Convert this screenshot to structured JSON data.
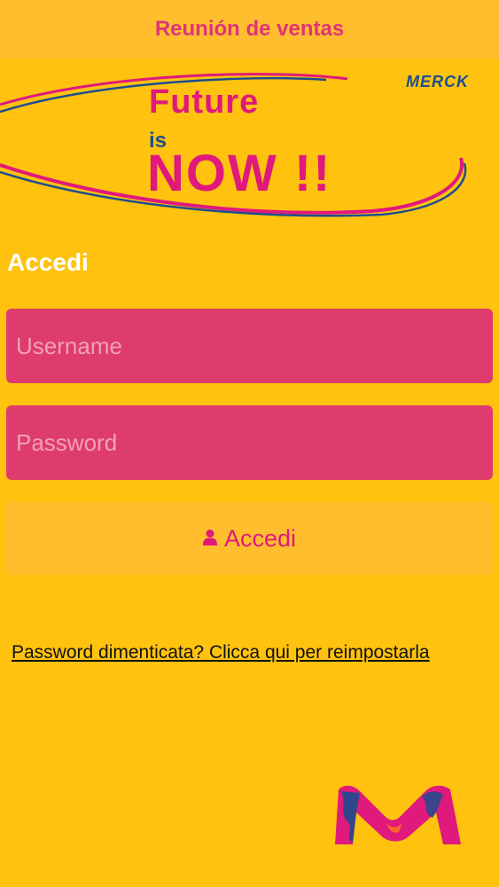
{
  "header": {
    "title": "Reunión de ventas"
  },
  "banner": {
    "brand": "MERCK",
    "line1": "Future",
    "line2": "is",
    "line3": "NOW !!"
  },
  "login": {
    "title": "Accedi",
    "username_placeholder": "Username",
    "password_placeholder": "Password",
    "submit_label": "Accedi",
    "forgot_link": "Password dimenticata? Clicca qui per reimpostarla"
  },
  "colors": {
    "background": "#FFC30F",
    "header_bg": "#FFBE2E",
    "accent_pink": "#E0197C",
    "field_bg": "#DE3B6E",
    "brand_blue": "#1C4E8E"
  },
  "icons": {
    "submit": "user-icon",
    "footer_logo": "merck-m-logo"
  }
}
